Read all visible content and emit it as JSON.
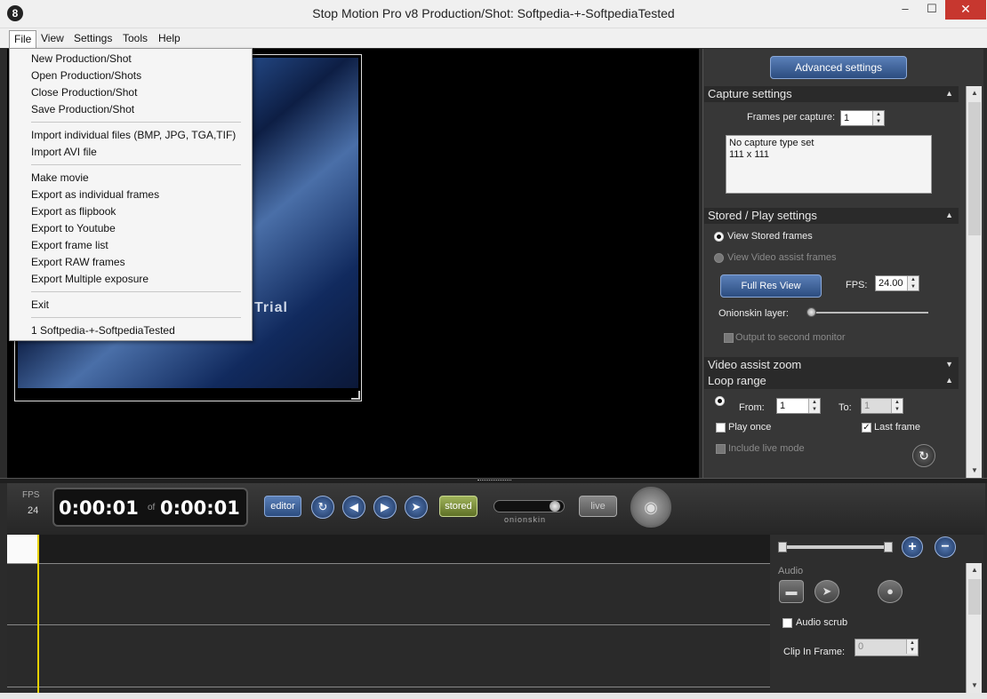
{
  "window": {
    "title": "Stop Motion Pro v8   Production/Shot: Softpedia-+-SoftpediaTested",
    "icon": "8",
    "minimize": "–",
    "maximize": "☐",
    "close": "✕"
  },
  "menubar": {
    "file": "File",
    "view": "View",
    "settings": "Settings",
    "tools": "Tools",
    "help": "Help"
  },
  "file_menu": {
    "new_production": "New Production/Shot",
    "open_production": "Open Production/Shots",
    "close_production": "Close Production/Shot",
    "save_production": "Save Production/Shot",
    "import_files": "Import individual files (BMP, JPG, TGA,TIF)",
    "import_avi": "Import AVI file",
    "make_movie": "Make movie",
    "export_frames": "Export as individual frames",
    "export_flipbook": "Export as flipbook",
    "export_youtube": "Export to Youtube",
    "export_frame_list": "Export frame list",
    "export_raw": "Export RAW frames",
    "export_multiple": "Export Multiple exposure",
    "exit": "Exit",
    "recent_1": "1 Softpedia-+-SoftpediaTested"
  },
  "preview": {
    "overlay_text": "Trial"
  },
  "right_panel": {
    "advanced_settings": "Advanced settings",
    "capture": {
      "header": "Capture settings",
      "frames_per_capture_label": "Frames per capture:",
      "frames_per_capture_value": "1",
      "info_line1": "No capture type set",
      "info_line2": "111 x 111"
    },
    "stored_play": {
      "header": "Stored / Play settings",
      "view_stored": "View Stored frames",
      "view_video_assist": "View Video assist frames",
      "full_res_view": "Full Res View",
      "fps_label": "FPS:",
      "fps_value": "24.00",
      "onionskin_layer": "Onionskin layer:",
      "output_second_monitor": "Output to second monitor"
    },
    "video_assist_zoom": {
      "header": "Video assist zoom"
    },
    "loop_range": {
      "header": "Loop range",
      "from_label": "From:",
      "from_value": "1",
      "to_label": "To:",
      "to_value": "1",
      "play_once": "Play once",
      "last_frame": "Last frame",
      "include_live": "Include live mode"
    }
  },
  "controls": {
    "fps_label": "FPS",
    "fps_value": "24",
    "current_time": "0:00:01",
    "of_label": "of",
    "total_time": "0:00:01",
    "editor": "editor",
    "stored": "stored",
    "onionskin": "onionskin",
    "live": "live"
  },
  "audio": {
    "label": "Audio",
    "audio_scrub": "Audio scrub",
    "clip_in_frame": "Clip In Frame:",
    "clip_in_value": "0"
  },
  "colors": {
    "accent_blue": "#2c4d80",
    "stored_green": "#9fb35a",
    "playhead": "#e8d200"
  }
}
